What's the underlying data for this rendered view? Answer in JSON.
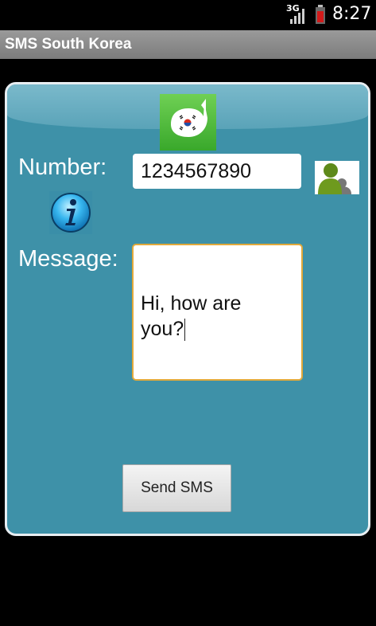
{
  "status_bar": {
    "network": "3G",
    "time": "8:27",
    "icons": [
      "signal-icon",
      "battery-icon"
    ]
  },
  "app": {
    "title": "SMS South Korea"
  },
  "form": {
    "number_label": "Number:",
    "number_value": "1234567890",
    "message_label": "Message:",
    "message_value": "Hi, how are\nyou?",
    "send_label": "Send SMS"
  },
  "icons": {
    "logo": "speech-bubble-korea-flag-icon",
    "contacts": "contacts-icon",
    "info": "info-icon"
  },
  "colors": {
    "panel": "#3e91a8",
    "logo_green": "#4cbc37",
    "message_border": "#e2a93a"
  }
}
